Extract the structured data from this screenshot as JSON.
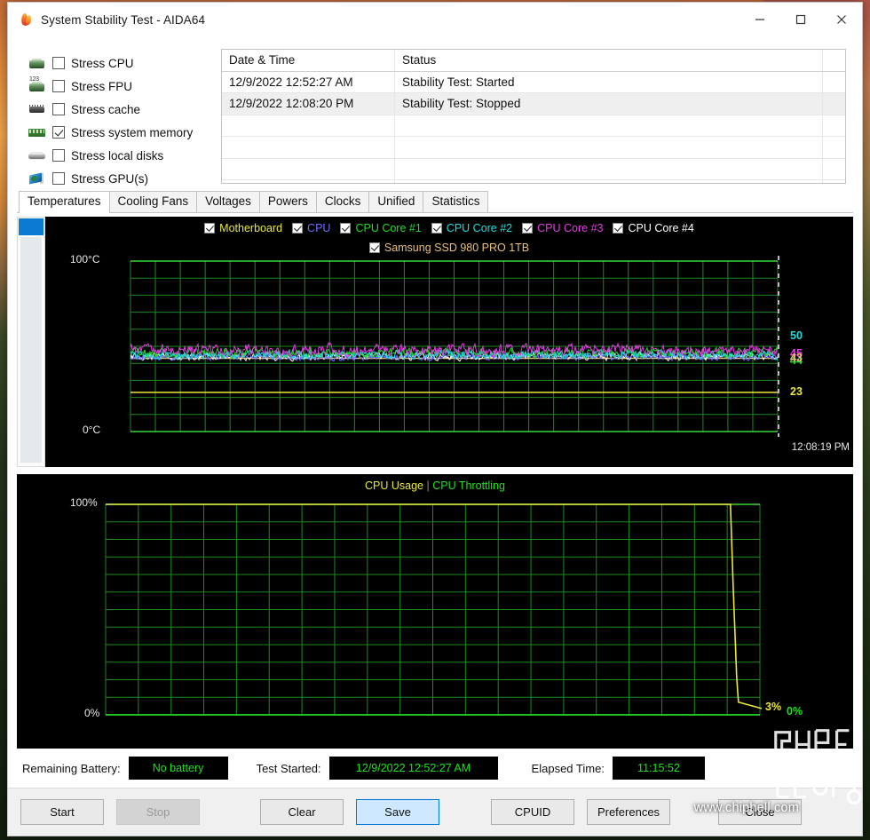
{
  "window": {
    "title": "System Stability Test - AIDA64",
    "icon": "flame-icon",
    "controls": {
      "minimize": "minimize-icon",
      "maximize": "maximize-icon",
      "close": "close-icon"
    }
  },
  "stress_options": [
    {
      "label": "Stress CPU",
      "checked": false,
      "icon": "cpu-chip-icon"
    },
    {
      "label": "Stress FPU",
      "checked": false,
      "icon": "fpu-chip-icon"
    },
    {
      "label": "Stress cache",
      "checked": false,
      "icon": "cache-chip-icon"
    },
    {
      "label": "Stress system memory",
      "checked": true,
      "icon": "memory-module-icon"
    },
    {
      "label": "Stress local disks",
      "checked": false,
      "icon": "hard-disk-icon"
    },
    {
      "label": "Stress GPU(s)",
      "checked": false,
      "icon": "gpu-card-icon"
    }
  ],
  "log": {
    "columns": [
      "Date & Time",
      "Status"
    ],
    "rows": [
      {
        "datetime": "12/9/2022 12:52:27 AM",
        "status": "Stability Test: Started"
      },
      {
        "datetime": "12/9/2022 12:08:20 PM",
        "status": "Stability Test: Stopped"
      }
    ],
    "empty_rows": 4
  },
  "tabs": [
    {
      "label": "Temperatures",
      "active": true
    },
    {
      "label": "Cooling Fans",
      "active": false
    },
    {
      "label": "Voltages",
      "active": false
    },
    {
      "label": "Powers",
      "active": false
    },
    {
      "label": "Clocks",
      "active": false
    },
    {
      "label": "Unified",
      "active": false
    },
    {
      "label": "Statistics",
      "active": false
    }
  ],
  "chart_data": [
    {
      "type": "line",
      "name": "temperatures",
      "title": "",
      "ylabel": "",
      "ylim": [
        0,
        100
      ],
      "y_tick_top": "100°C",
      "y_tick_bottom": "0°C",
      "x_last_label": "12:08:19 PM",
      "grid": true,
      "legend_position": "top",
      "series": [
        {
          "name": "Motherboard",
          "color": "#e8e83c",
          "checked": true,
          "last_value": "23",
          "last_value_y": 23
        },
        {
          "name": "CPU",
          "color": "#6e6eff",
          "checked": true,
          "last_value": "44",
          "last_value_y": 44
        },
        {
          "name": "CPU Core #1",
          "color": "#22dd22",
          "checked": true,
          "last_value": "44",
          "last_value_y": 44
        },
        {
          "name": "CPU Core #2",
          "color": "#22dddd",
          "checked": true,
          "last_value": "50",
          "last_value_y": 50
        },
        {
          "name": "CPU Core #3",
          "color": "#e040e0",
          "checked": true,
          "last_value": "45",
          "last_value_y": 45
        },
        {
          "name": "CPU Core #4",
          "color": "#ffffff",
          "checked": true,
          "last_value": "44",
          "last_value_y": 44
        },
        {
          "name": "Samsung SSD 980 PRO 1TB",
          "color": "#e8c07a",
          "checked": true,
          "last_value": "43",
          "last_value_y": 43
        }
      ],
      "edge_labels": [
        {
          "text": "50",
          "color": "#22dddd",
          "y_pct": 50
        },
        {
          "text": "45",
          "color": "#e040e0",
          "y_pct": 45
        },
        {
          "text": "44",
          "color": "#22dd22",
          "y_pct": 44
        },
        {
          "text": "43",
          "color": "#e8c07a",
          "y_pct": 43
        },
        {
          "text": "23",
          "color": "#e8e83c",
          "y_pct": 23
        }
      ]
    },
    {
      "type": "line",
      "name": "cpu-usage",
      "title_parts": [
        {
          "text": "CPU Usage",
          "color": "#e8e83c"
        },
        {
          "text": "|",
          "color": "#888888"
        },
        {
          "text": "CPU Throttling",
          "color": "#22dd22"
        }
      ],
      "ylim": [
        0,
        100
      ],
      "y_tick_top": "100%",
      "y_tick_bottom": "0%",
      "grid": true,
      "series": [
        {
          "name": "CPU Usage",
          "color": "#e8e83c",
          "last_value": "3%",
          "last_value_y": 3
        },
        {
          "name": "CPU Throttling",
          "color": "#22dd22",
          "last_value": "0%",
          "last_value_y": 0
        }
      ]
    }
  ],
  "status": {
    "battery_label": "Remaining Battery:",
    "battery_value": "No battery",
    "started_label": "Test Started:",
    "started_value": "12/9/2022 12:52:27 AM",
    "elapsed_label": "Elapsed Time:",
    "elapsed_value": "11:15:52",
    "value_color": "#22e022"
  },
  "buttons": [
    {
      "label": "Start",
      "state": "normal"
    },
    {
      "label": "Stop",
      "state": "disabled"
    },
    {
      "label": "Clear",
      "state": "normal"
    },
    {
      "label": "Save",
      "state": "focused"
    },
    {
      "label": "CPUID",
      "state": "normal"
    },
    {
      "label": "Preferences",
      "state": "normal"
    },
    {
      "label": "Close",
      "state": "normal"
    }
  ],
  "watermark": {
    "text": "www.chiphell.com",
    "logo": "chiphell-logo"
  }
}
